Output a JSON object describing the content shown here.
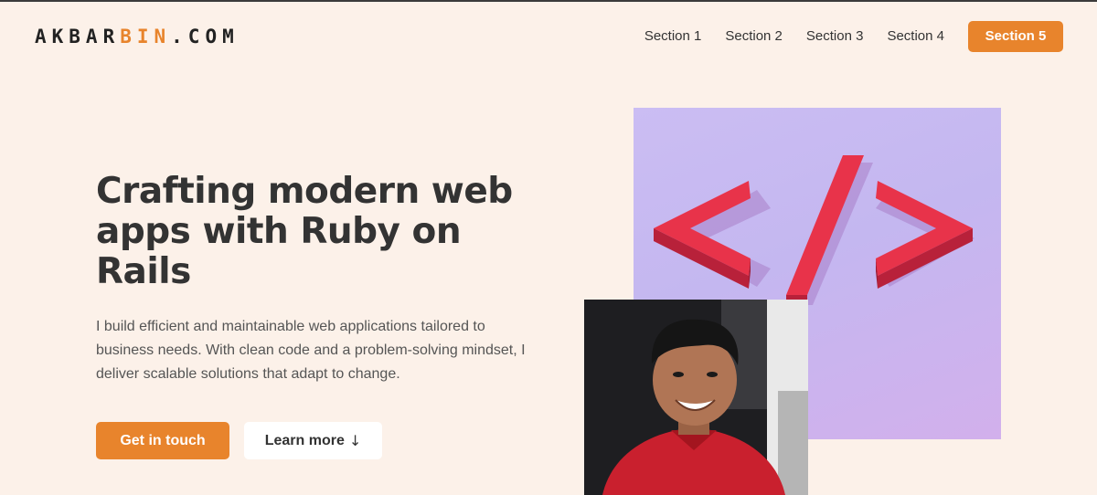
{
  "brand": {
    "logo_part1": "AKBAR",
    "logo_part2": "BIN",
    "logo_part3": ".COM",
    "accent_color": "#e8842c"
  },
  "nav": {
    "items": [
      "Section 1",
      "Section 2",
      "Section 3",
      "Section 4"
    ],
    "cta": "Section 5"
  },
  "hero": {
    "title": "Crafting modern web apps with Ruby on Rails",
    "description": "I build efficient and maintainable web applications tailored to business needs. With clean code and a problem-solving mindset, I deliver scalable solutions that adapt to change.",
    "primary_button": "Get in touch",
    "secondary_button": "Learn more",
    "secondary_icon": "↓"
  },
  "images": {
    "code_image_icon": "code-brackets-icon",
    "portrait_icon": "person-photo"
  },
  "colors": {
    "background": "#fcf1e9",
    "text": "#333333",
    "code_symbol": "#e8334a",
    "code_bg": "#c4b7f0"
  }
}
